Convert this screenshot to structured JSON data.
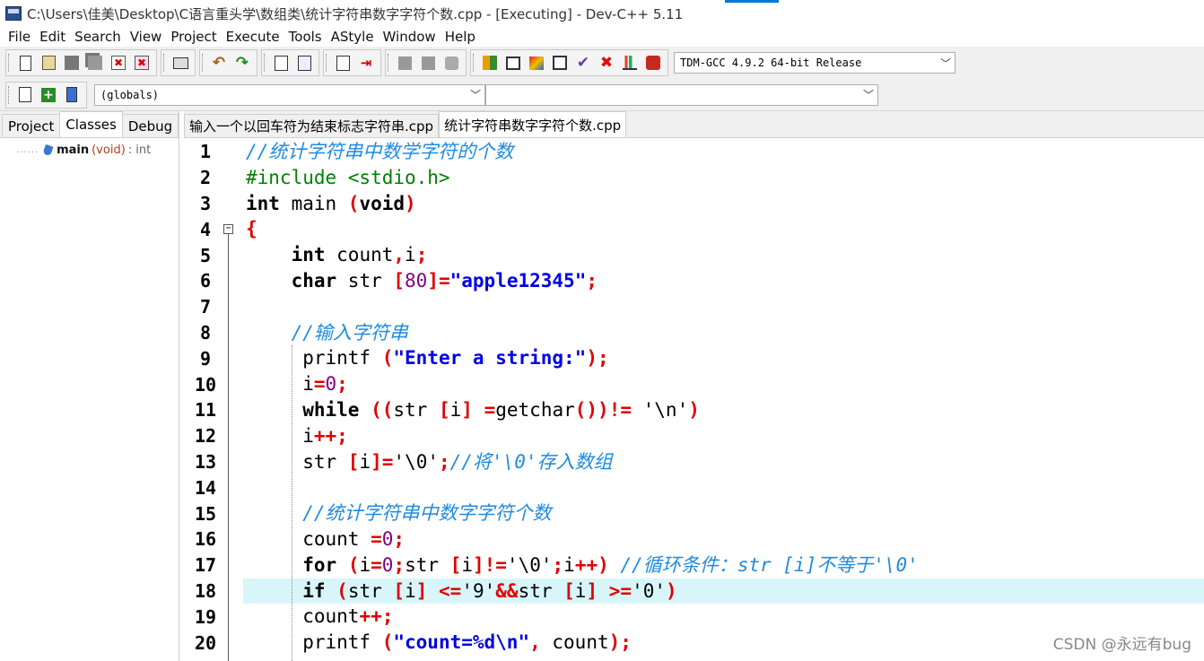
{
  "window": {
    "title": "C:\\Users\\佳美\\Desktop\\C语言重头学\\数组类\\统计字符串数字字符个数.cpp - [Executing] - Dev-C++ 5.11"
  },
  "menu": [
    "File",
    "Edit",
    "Search",
    "View",
    "Project",
    "Execute",
    "Tools",
    "AStyle",
    "Window",
    "Help"
  ],
  "toolbar": {
    "compiler_select": "TDM-GCC 4.9.2 64-bit Release",
    "scope_select": "(globals)",
    "member_select": ""
  },
  "left_panel": {
    "tabs": [
      "Project",
      "Classes",
      "Debug"
    ],
    "active_tab": "Classes",
    "tree": [
      {
        "name": "main",
        "sig": "(void)",
        "ret": ": int"
      }
    ]
  },
  "editor": {
    "tabs": [
      "输入一个以回车符为结束标志字符串.cpp",
      "统计字符串数字字符个数.cpp"
    ],
    "active_tab": "统计字符串数字字符个数.cpp",
    "highlighted_line": 18,
    "lines": [
      {
        "n": "1",
        "t": [
          [
            "cmt",
            "//统计字符串中数学字符的个数"
          ]
        ]
      },
      {
        "n": "2",
        "t": [
          [
            "pp",
            "#include <stdio.h>"
          ]
        ]
      },
      {
        "n": "3",
        "t": [
          [
            "kw",
            "int"
          ],
          [
            "plain",
            " main "
          ],
          [
            "sym",
            "("
          ],
          [
            "kw",
            "void"
          ],
          [
            "sym",
            ")"
          ]
        ]
      },
      {
        "n": "4",
        "t": [
          [
            "sym",
            "{"
          ]
        ]
      },
      {
        "n": "5",
        "t": [
          [
            "plain",
            "    "
          ],
          [
            "kw",
            "int"
          ],
          [
            "plain",
            " count"
          ],
          [
            "sym",
            ","
          ],
          [
            "plain",
            "i"
          ],
          [
            "sym",
            ";"
          ]
        ]
      },
      {
        "n": "6",
        "t": [
          [
            "plain",
            "    "
          ],
          [
            "kw",
            "char"
          ],
          [
            "plain",
            " str "
          ],
          [
            "sym",
            "["
          ],
          [
            "num",
            "80"
          ],
          [
            "sym",
            "]="
          ],
          [
            "str",
            "\"apple12345\""
          ],
          [
            "sym",
            ";"
          ]
        ]
      },
      {
        "n": "7",
        "t": []
      },
      {
        "n": "8",
        "t": [
          [
            "plain",
            "    "
          ],
          [
            "cmt",
            "//输入字符串"
          ]
        ]
      },
      {
        "n": "9",
        "t": [
          [
            "plain",
            "     printf "
          ],
          [
            "sym",
            "("
          ],
          [
            "str",
            "\"Enter a string:\""
          ],
          [
            "sym",
            ");"
          ]
        ]
      },
      {
        "n": "10",
        "t": [
          [
            "plain",
            "     i"
          ],
          [
            "sym",
            "="
          ],
          [
            "num",
            "0"
          ],
          [
            "sym",
            ";"
          ]
        ]
      },
      {
        "n": "11",
        "t": [
          [
            "plain",
            "     "
          ],
          [
            "kw",
            "while"
          ],
          [
            "plain",
            " "
          ],
          [
            "sym",
            "(("
          ],
          [
            "plain",
            "str "
          ],
          [
            "sym",
            "["
          ],
          [
            "plain",
            "i"
          ],
          [
            "sym",
            "]"
          ],
          [
            "plain",
            " "
          ],
          [
            "sym",
            "="
          ],
          [
            "plain",
            "getchar"
          ],
          [
            "sym",
            "())!="
          ],
          [
            "plain",
            " "
          ],
          [
            "chr",
            "'\\n'"
          ],
          [
            "sym",
            ")"
          ]
        ]
      },
      {
        "n": "12",
        "t": [
          [
            "plain",
            "     i"
          ],
          [
            "sym",
            "++;"
          ]
        ]
      },
      {
        "n": "13",
        "t": [
          [
            "plain",
            "     str "
          ],
          [
            "sym",
            "["
          ],
          [
            "plain",
            "i"
          ],
          [
            "sym",
            "]="
          ],
          [
            "chr",
            "'\\0'"
          ],
          [
            "sym",
            ";"
          ],
          [
            "cmt",
            "//将'\\0'存入数组"
          ]
        ]
      },
      {
        "n": "14",
        "t": []
      },
      {
        "n": "15",
        "t": [
          [
            "plain",
            "     "
          ],
          [
            "cmt",
            "//统计字符串中数字字符个数"
          ]
        ]
      },
      {
        "n": "16",
        "t": [
          [
            "plain",
            "     count "
          ],
          [
            "sym",
            "="
          ],
          [
            "num",
            "0"
          ],
          [
            "sym",
            ";"
          ]
        ]
      },
      {
        "n": "17",
        "t": [
          [
            "plain",
            "     "
          ],
          [
            "kw",
            "for"
          ],
          [
            "plain",
            " "
          ],
          [
            "sym",
            "("
          ],
          [
            "plain",
            "i"
          ],
          [
            "sym",
            "="
          ],
          [
            "num",
            "0"
          ],
          [
            "sym",
            ";"
          ],
          [
            "plain",
            "str "
          ],
          [
            "sym",
            "["
          ],
          [
            "plain",
            "i"
          ],
          [
            "sym",
            "]!="
          ],
          [
            "chr",
            "'\\0'"
          ],
          [
            "sym",
            ";"
          ],
          [
            "plain",
            "i"
          ],
          [
            "sym",
            "++)"
          ],
          [
            "plain",
            " "
          ],
          [
            "cmt",
            "//循环条件：str [i]不等于'\\0'"
          ]
        ]
      },
      {
        "n": "18",
        "t": [
          [
            "plain",
            "     "
          ],
          [
            "kw",
            "if"
          ],
          [
            "plain",
            " "
          ],
          [
            "sym",
            "("
          ],
          [
            "plain",
            "str "
          ],
          [
            "sym",
            "["
          ],
          [
            "plain",
            "i"
          ],
          [
            "sym",
            "]"
          ],
          [
            "plain",
            " "
          ],
          [
            "sym",
            "<="
          ],
          [
            "chr",
            "'9'"
          ],
          [
            "sym",
            "&&"
          ],
          [
            "plain",
            "str "
          ],
          [
            "sym",
            "["
          ],
          [
            "plain",
            "i"
          ],
          [
            "sym",
            "]"
          ],
          [
            "plain",
            " "
          ],
          [
            "sym",
            ">="
          ],
          [
            "chr",
            "'0'"
          ],
          [
            "sym",
            ")"
          ]
        ]
      },
      {
        "n": "19",
        "t": [
          [
            "plain",
            "     count"
          ],
          [
            "sym",
            "++;"
          ]
        ]
      },
      {
        "n": "20",
        "t": [
          [
            "plain",
            "     printf "
          ],
          [
            "sym",
            "("
          ],
          [
            "str",
            "\"count=%d\\n\""
          ],
          [
            "sym",
            ","
          ],
          [
            "plain",
            " count"
          ],
          [
            "sym",
            ");"
          ]
        ]
      }
    ]
  },
  "watermark": "CSDN @永远有bug",
  "colors": {
    "keyword": "#000000",
    "preprocessor": "#008000",
    "symbol": "#e00000",
    "string": "#0000e6",
    "number": "#800080",
    "comment": "#1f8be0",
    "highlight_line": "#d8f6fa"
  },
  "toolbar_icons": {
    "row1_group1": [
      "new-file-icon",
      "open-file-icon",
      "save-icon",
      "save-all-icon",
      "close-icon",
      "close-all-icon"
    ],
    "row1_group2": [
      "print-icon"
    ],
    "row1_group3": [
      "undo-icon",
      "redo-icon"
    ],
    "row1_group4": [
      "find-icon",
      "replace-icon"
    ],
    "row1_group5": [
      "goto-line-icon",
      "goto-function-icon"
    ],
    "row1_group6": [
      "indent-icon",
      "unindent-icon",
      "toggle-comment-icon"
    ],
    "row1_group7": [
      "grid-icon",
      "window-icon",
      "color-icon",
      "layout-icon",
      "check-icon",
      "stop-icon",
      "chart-icon",
      "debug-icon"
    ],
    "row2_group1": [
      "new-project-icon",
      "add-file-icon",
      "class-browser-icon"
    ]
  }
}
